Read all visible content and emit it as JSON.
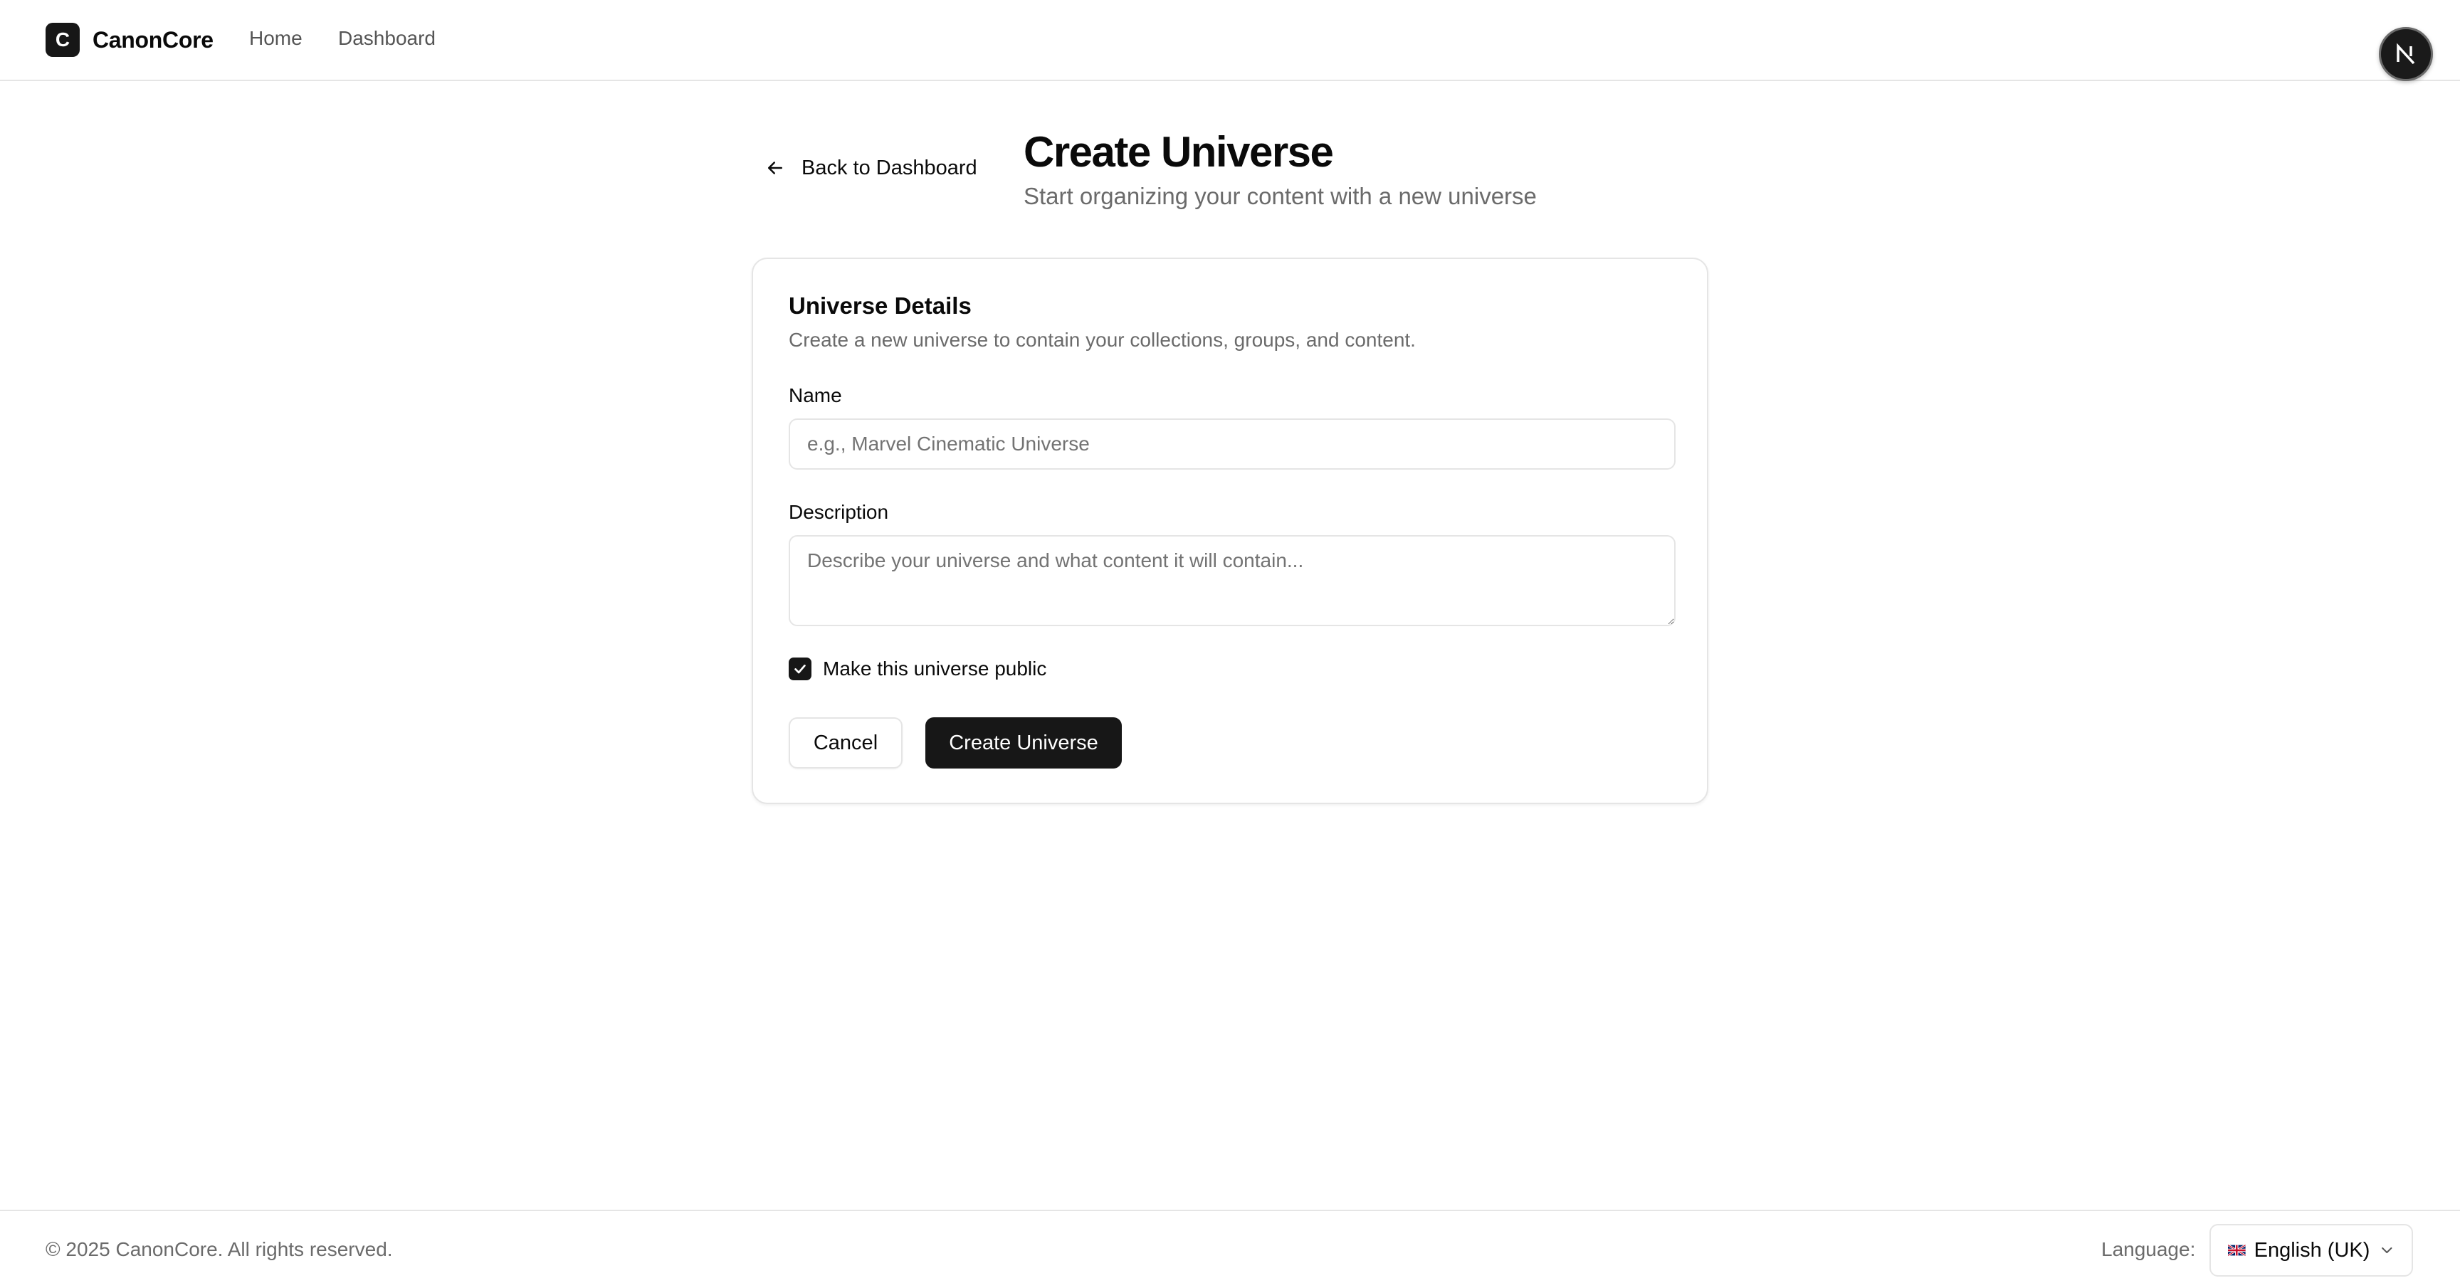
{
  "header": {
    "logo_letter": "C",
    "brand": "CanonCore",
    "nav": {
      "home": "Home",
      "dashboard": "Dashboard"
    },
    "avatar_letter": "N"
  },
  "page": {
    "back_label": "Back to Dashboard",
    "title": "Create Universe",
    "subtitle": "Start organizing your content with a new universe"
  },
  "form": {
    "card_title": "Universe Details",
    "card_description": "Create a new universe to contain your collections, groups, and content.",
    "name_label": "Name",
    "name_value": "",
    "name_placeholder": "e.g., Marvel Cinematic Universe",
    "description_label": "Description",
    "description_value": "",
    "description_placeholder": "Describe your universe and what content it will contain...",
    "public_checkbox_label": "Make this universe public",
    "public_checked": true,
    "cancel_label": "Cancel",
    "submit_label": "Create Universe"
  },
  "footer": {
    "copyright": "© 2025 CanonCore. All rights reserved.",
    "language_label": "Language:",
    "language_value": "English (UK)"
  },
  "icons": {
    "back": "arrow-left-icon",
    "checkbox": "check-icon",
    "language_flag": "uk-flag-icon",
    "language_dropdown": "chevron-down-icon"
  },
  "colors": {
    "primary": "#171717",
    "border": "#e5e5e5",
    "muted_text": "#6b6b6b",
    "background": "#ffffff"
  }
}
